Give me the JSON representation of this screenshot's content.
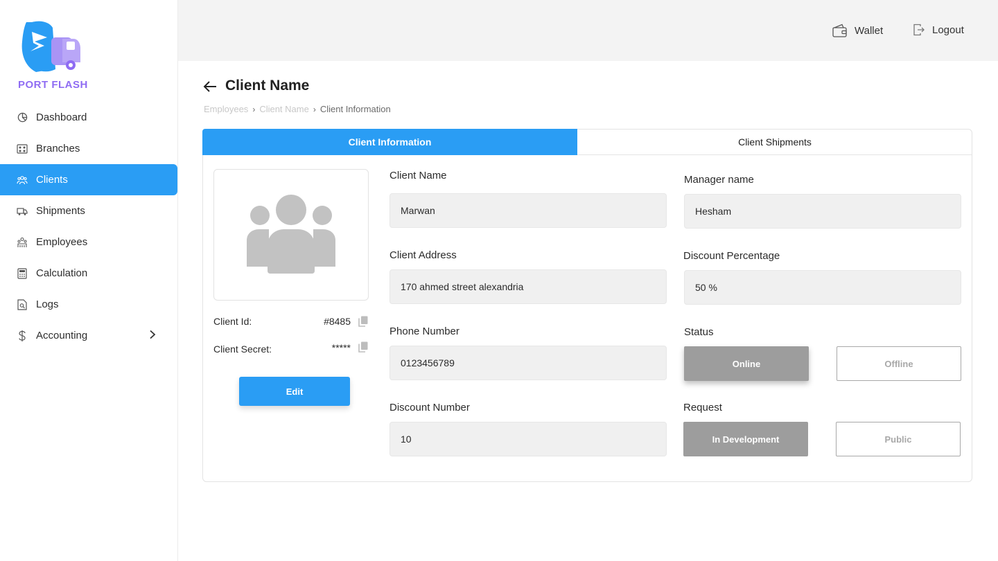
{
  "brand": {
    "name": "PORT FLASH"
  },
  "sidebar": {
    "items": [
      {
        "label": "Dashboard",
        "icon": "dashboard-icon"
      },
      {
        "label": "Branches",
        "icon": "branches-icon"
      },
      {
        "label": "Clients",
        "icon": "clients-icon",
        "active": true
      },
      {
        "label": "Shipments",
        "icon": "truck-icon"
      },
      {
        "label": "Employees",
        "icon": "employees-icon"
      },
      {
        "label": "Calculation",
        "icon": "calculator-icon"
      },
      {
        "label": "Logs",
        "icon": "logs-icon"
      },
      {
        "label": "Accounting",
        "icon": "dollar-icon",
        "has_submenu": true
      }
    ]
  },
  "topbar": {
    "wallet_label": "Wallet",
    "logout_label": "Logout"
  },
  "page": {
    "title": "Client Name",
    "breadcrumb": [
      "Employees",
      "Client Name",
      "Client Information"
    ]
  },
  "tabs": {
    "info": "Client Information",
    "shipments": "Client Shipments"
  },
  "client": {
    "id_label": "Client Id:",
    "id_value": "#8485",
    "secret_label": "Client Secret:",
    "secret_value": "*****",
    "edit_label": "Edit"
  },
  "form": {
    "client_name": {
      "label": "Client Name",
      "value": "Marwan"
    },
    "manager_name": {
      "label": "Manager name",
      "value": "Hesham"
    },
    "client_address": {
      "label": "Client Address",
      "value": "170 ahmed street alexandria"
    },
    "discount_percentage": {
      "label": "Discount Percentage",
      "value": "50 %"
    },
    "phone_number": {
      "label": "Phone Number",
      "value": "0123456789"
    },
    "discount_number": {
      "label": "Discount Number",
      "value": "10"
    },
    "status": {
      "label": "Status",
      "on": "Online",
      "off": "Offline"
    },
    "request": {
      "label": "Request",
      "on": "In Development",
      "off": "Public"
    }
  },
  "colors": {
    "accent": "#2a9df4",
    "brand_purple": "#8f6cf3",
    "selected_gray": "#9d9d9d"
  }
}
